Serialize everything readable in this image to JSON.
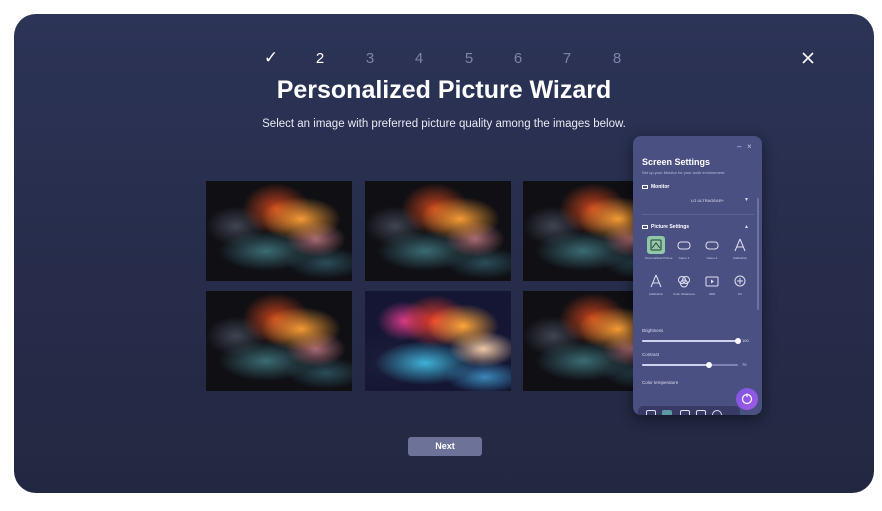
{
  "wizard": {
    "steps": [
      "✓",
      "2",
      "3",
      "4",
      "5",
      "6",
      "7",
      "8"
    ],
    "current_step": 2,
    "title": "Personalized Picture Wizard",
    "subtitle": "Select an image with preferred picture quality among the images below.",
    "next_label": "Next",
    "selected_image_index": 4
  },
  "screen_settings": {
    "title": "Screen Settings",
    "subtitle": "Set up your Monitor for your work environment.",
    "monitor_section": "Monitor",
    "monitor_value": "LG ULTRAGEAR+",
    "picture_section": "Picture Settings",
    "modes": [
      "Personalized Picture",
      "Game 1",
      "Game 2",
      "Calibration",
      "Calibration",
      "Color Weakness",
      "HDR",
      "PC"
    ],
    "brightness_label": "Brightness",
    "brightness_value": "100",
    "contrast_label": "Contrast",
    "contrast_value": "70",
    "color_temperature_label": "Color temperature"
  },
  "colors": {
    "background": "#262c4a",
    "panel": "#4b5083",
    "next_button": "#6d7299",
    "selected_mode": "#8fc8a4",
    "fab": "#8b58e4"
  }
}
